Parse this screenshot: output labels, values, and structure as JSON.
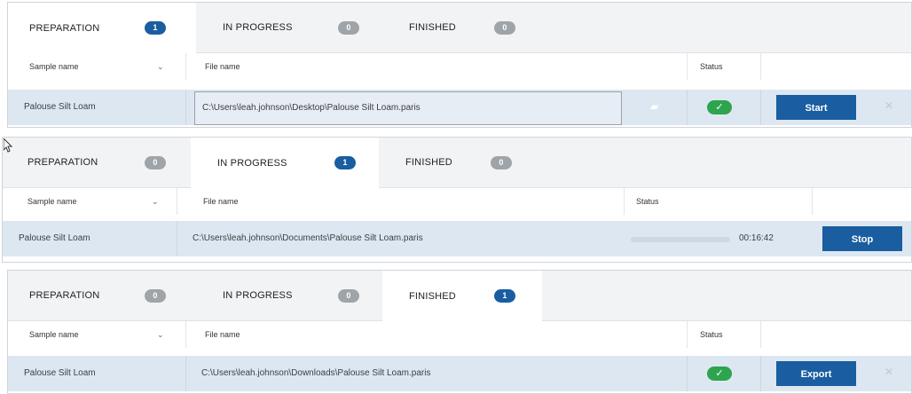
{
  "panels": [
    {
      "tabs": [
        {
          "label": "PREPARATION",
          "count": "1",
          "active": true
        },
        {
          "label": "IN PROGRESS",
          "count": "0",
          "active": false
        },
        {
          "label": "FINISHED",
          "count": "0",
          "active": false
        }
      ],
      "columns": {
        "sample": "Sample name",
        "file": "File name",
        "status": "Status"
      },
      "row": {
        "sample": "Palouse Silt Loam",
        "file": "C:\\Users\\leah.johnson\\Desktop\\Palouse Silt Loam.paris",
        "status_icon": "check-icon",
        "action": "Start"
      }
    },
    {
      "tabs": [
        {
          "label": "PREPARATION",
          "count": "0",
          "active": false
        },
        {
          "label": "IN PROGRESS",
          "count": "1",
          "active": true
        },
        {
          "label": "FINISHED",
          "count": "0",
          "active": false
        }
      ],
      "columns": {
        "sample": "Sample name",
        "file": "File name",
        "status": "Status"
      },
      "row": {
        "sample": "Palouse Silt Loam",
        "file": "C:\\Users\\leah.johnson\\Documents\\Palouse Silt Loam.paris",
        "elapsed": "00:16:42",
        "action": "Stop"
      }
    },
    {
      "tabs": [
        {
          "label": "PREPARATION",
          "count": "0",
          "active": false
        },
        {
          "label": "IN PROGRESS",
          "count": "0",
          "active": false
        },
        {
          "label": "FINISHED",
          "count": "1",
          "active": true
        }
      ],
      "columns": {
        "sample": "Sample name",
        "file": "File name",
        "status": "Status"
      },
      "row": {
        "sample": "Palouse Silt Loam",
        "file": "C:\\Users\\leah.johnson\\Downloads\\Palouse Silt Loam.paris",
        "status_icon": "check-icon",
        "action": "Export"
      }
    }
  ],
  "colors": {
    "accent": "#1a5da0",
    "success": "#2ea44f",
    "row_bg": "#dde7f1"
  }
}
